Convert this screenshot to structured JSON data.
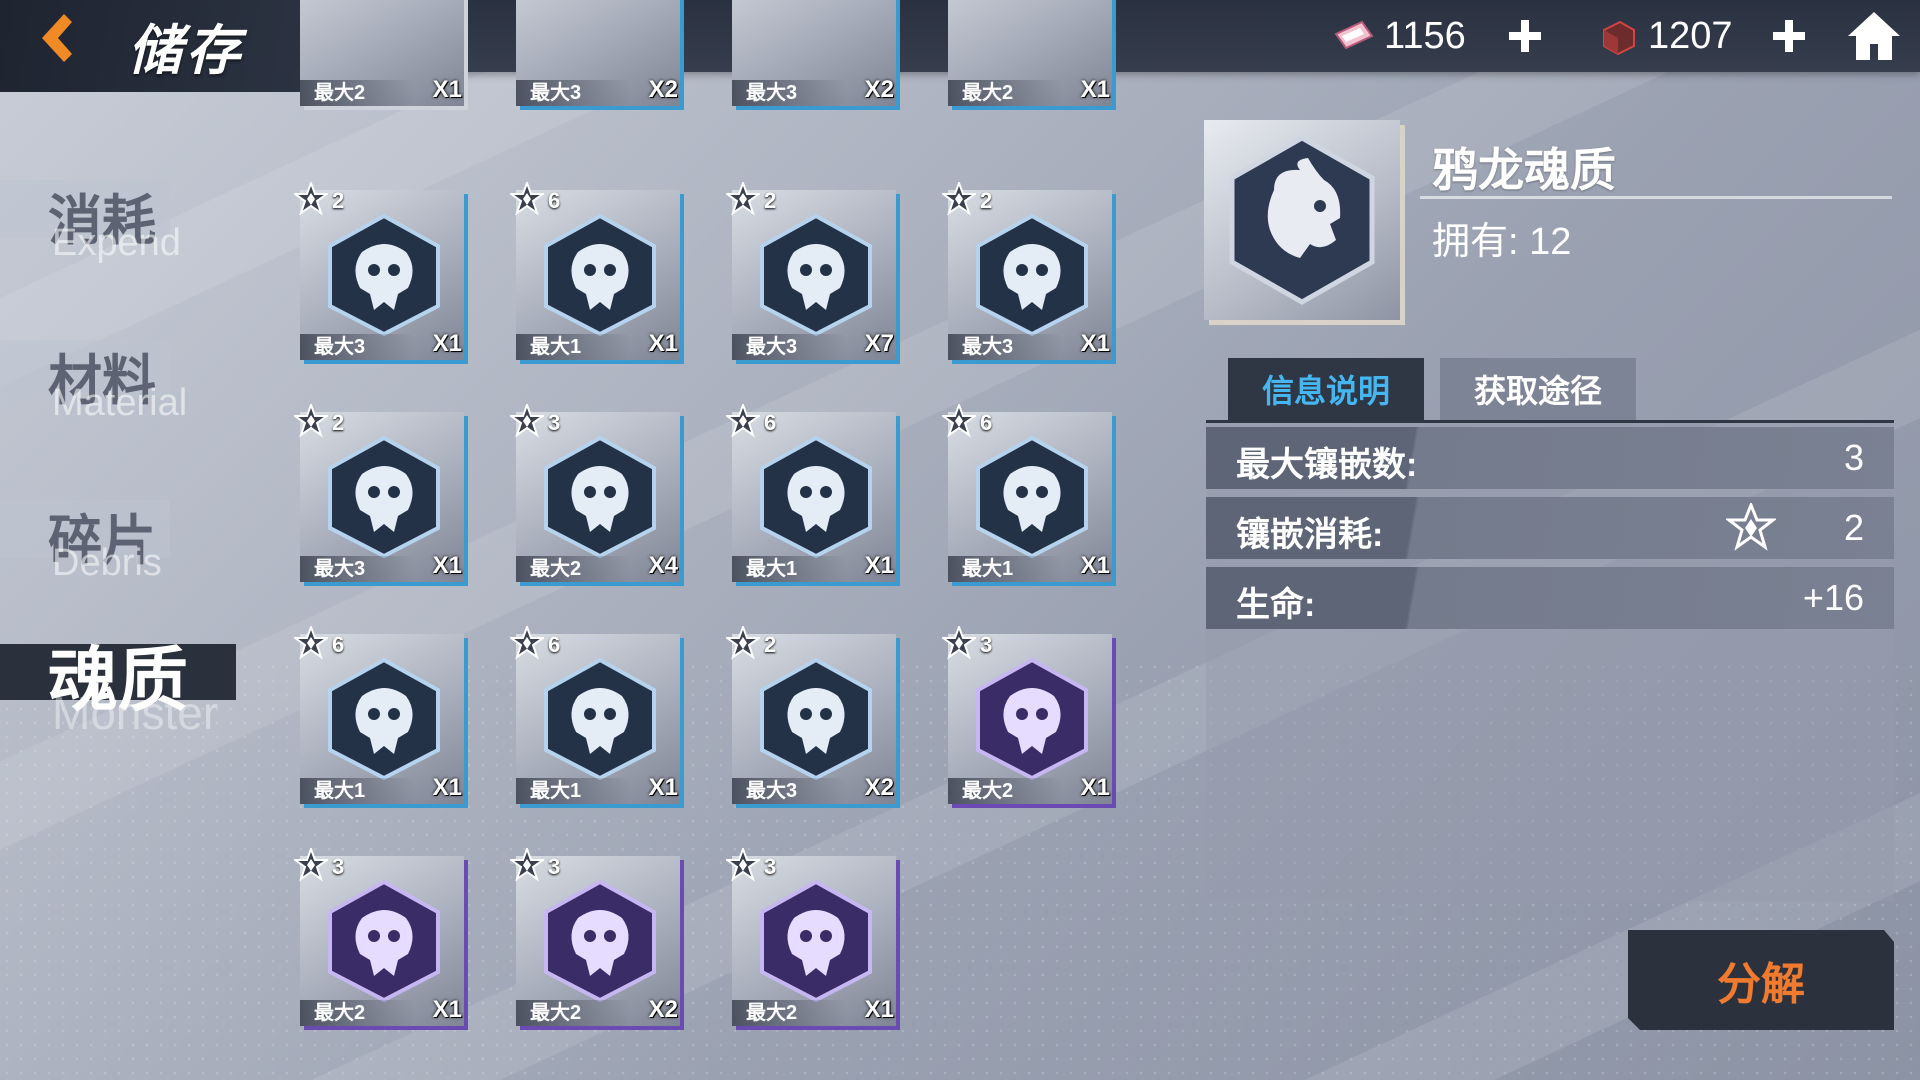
{
  "header": {
    "title": "储存",
    "currency1": "1156",
    "currency2": "1207"
  },
  "categories": [
    {
      "cn": "消耗",
      "en": "Expend"
    },
    {
      "cn": "材料",
      "en": "Material"
    },
    {
      "cn": "碎片",
      "en": "Debris"
    },
    {
      "cn": "魂质",
      "en": "Monster"
    }
  ],
  "top_row": [
    {
      "max": "最大2",
      "qty": "X1"
    },
    {
      "max": "最大3",
      "qty": "X2"
    },
    {
      "max": "最大3",
      "qty": "X2"
    },
    {
      "max": "最大2",
      "qty": "X1"
    }
  ],
  "items": [
    {
      "rank": "2",
      "max": "最大3",
      "qty": "X1",
      "icon": "skull-antler-icon"
    },
    {
      "rank": "6",
      "max": "最大1",
      "qty": "X1",
      "icon": "skull-fan-icon"
    },
    {
      "rank": "2",
      "max": "最大3",
      "qty": "X7",
      "icon": "skull-horn-icon"
    },
    {
      "rank": "2",
      "max": "最大3",
      "qty": "X1",
      "icon": "skull-fang-icon"
    },
    {
      "rank": "2",
      "max": "最大3",
      "qty": "X1",
      "icon": "beast-head-icon"
    },
    {
      "rank": "3",
      "max": "最大2",
      "qty": "X4",
      "icon": "skull-crossed-icon"
    },
    {
      "rank": "6",
      "max": "最大1",
      "qty": "X1",
      "icon": "skull-shield-icon"
    },
    {
      "rank": "6",
      "max": "最大1",
      "qty": "X1",
      "icon": "skull-crab-icon"
    },
    {
      "rank": "6",
      "max": "最大1",
      "qty": "X1",
      "icon": "demon-mask-icon"
    },
    {
      "rank": "6",
      "max": "最大1",
      "qty": "X1",
      "icon": "ram-horn-icon"
    },
    {
      "rank": "2",
      "max": "最大3",
      "qty": "X2",
      "icon": "tentacle-head-icon"
    },
    {
      "rank": "3",
      "max": "最大2",
      "qty": "X1",
      "icon": "crowned-skull-icon"
    },
    {
      "rank": "3",
      "max": "最大2",
      "qty": "X1",
      "icon": "dragon-head-icon"
    },
    {
      "rank": "3",
      "max": "最大2",
      "qty": "X2",
      "icon": "skull-horn-icon"
    },
    {
      "rank": "3",
      "max": "最大2",
      "qty": "X1",
      "icon": "kraken-icon"
    }
  ],
  "detail": {
    "name": "鸦龙魂质",
    "owned": "拥有: 12",
    "tab_info": "信息说明",
    "tab_source": "获取途径",
    "rows": [
      {
        "label": "最大镶嵌数:",
        "value": "3"
      },
      {
        "label": "镶嵌消耗:",
        "value": "2"
      },
      {
        "label": "生命:",
        "value": "+16"
      }
    ],
    "decompose": "分解"
  }
}
